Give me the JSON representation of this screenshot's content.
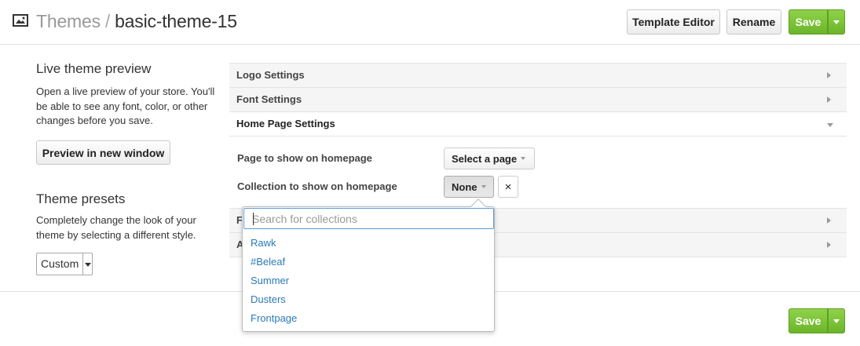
{
  "header": {
    "section": "Themes",
    "separator": "/",
    "theme_name": "basic-theme-15",
    "template_editor_label": "Template Editor",
    "rename_label": "Rename",
    "save_label": "Save"
  },
  "sidebar": {
    "preview_title": "Live theme preview",
    "preview_desc": "Open a live preview of your store. You'll be able to see any font, color, or other changes before you save.",
    "preview_button": "Preview in new window",
    "presets_title": "Theme presets",
    "presets_desc": "Completely change the look of your theme by selecting a different style.",
    "preset_value": "Custom"
  },
  "accordion": {
    "logo": "Logo Settings",
    "font": "Font Settings",
    "home": "Home Page Settings",
    "hidden1_initial": "F",
    "hidden2_initial": "A"
  },
  "homepage": {
    "page_label": "Page to show on homepage",
    "page_value": "Select a page",
    "collection_label": "Collection to show on homepage",
    "collection_value": "None",
    "clear_symbol": "×"
  },
  "collections_dropdown": {
    "placeholder": "Search for collections",
    "options": [
      "Rawk",
      "#Beleaf",
      "Summer",
      "Dusters",
      "Frontpage"
    ]
  },
  "footer": {
    "save_label": "Save"
  },
  "colors": {
    "accent_green": "#7cc33a",
    "link_blue": "#2a7ab8"
  }
}
